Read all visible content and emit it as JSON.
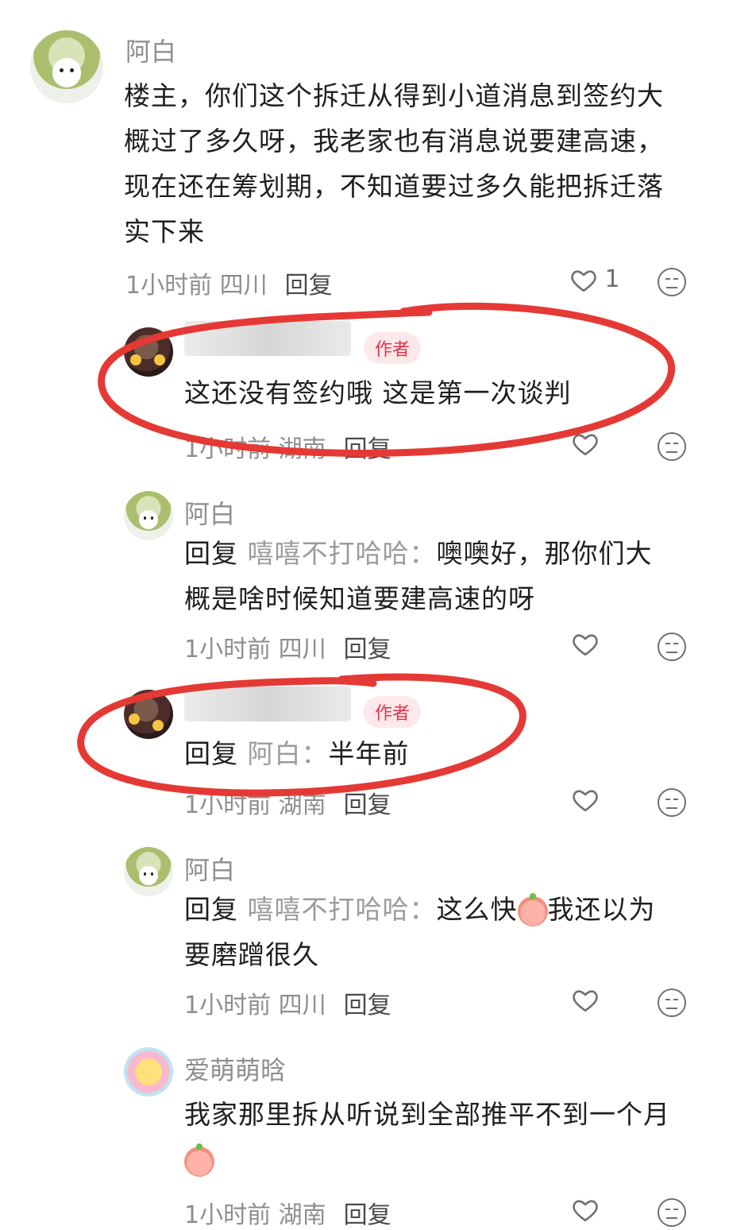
{
  "comments": [
    {
      "name": "阿白",
      "text": "楼主，你们这个拆迁从得到小道消息到签约大概过了多久呀，我老家也有消息说要建高速，现在还在筹划期，不知道要过多久能把拆迁落实下来",
      "lines": [
        "楼主，你们这个拆迁从得到小道消息到签约大",
        "概过了多久呀，我老家也有消息说要建高速，",
        "现在还在筹划期，不知道要过多久能把拆迁落",
        "实下来"
      ],
      "time": "1小时前",
      "location": "四川",
      "reply_label": "回复",
      "likes": "1"
    },
    {
      "badge": "作者",
      "text": "这还没有签约哦 这是第一次谈判",
      "time": "1小时前",
      "location": "湖南",
      "reply_label": "回复"
    },
    {
      "name": "阿白",
      "reply_prefix": "回复",
      "reply_target": "嘻嘻不打哈哈：",
      "lines": [
        "噢噢好，那你们大",
        "概是啥时候知道要建高速的呀"
      ],
      "time": "1小时前",
      "location": "四川",
      "reply_label": "回复"
    },
    {
      "badge": "作者",
      "reply_prefix": "回复",
      "reply_target": "阿白：",
      "text": "半年前",
      "time": "1小时前",
      "location": "湖南",
      "reply_label": "回复"
    },
    {
      "name": "阿白",
      "reply_prefix": "回复",
      "reply_target": "嘻嘻不打哈哈：",
      "text_before_emoji": "这么快",
      "text_after_emoji": "我还以为",
      "line2": "要磨蹭很久",
      "time": "1小时前",
      "location": "四川",
      "reply_label": "回复"
    },
    {
      "name": "爱萌萌晗",
      "lines": [
        "我家那里拆从听说到全部推平不到一个月"
      ],
      "time": "1小时前",
      "location": "湖南",
      "reply_label": "回复"
    }
  ],
  "colors": {
    "annotation_red": "#e53935",
    "author_badge": "#e0344d"
  },
  "icons": [
    "heart-icon",
    "dislike-face-icon",
    "peach-cry-emoji"
  ]
}
